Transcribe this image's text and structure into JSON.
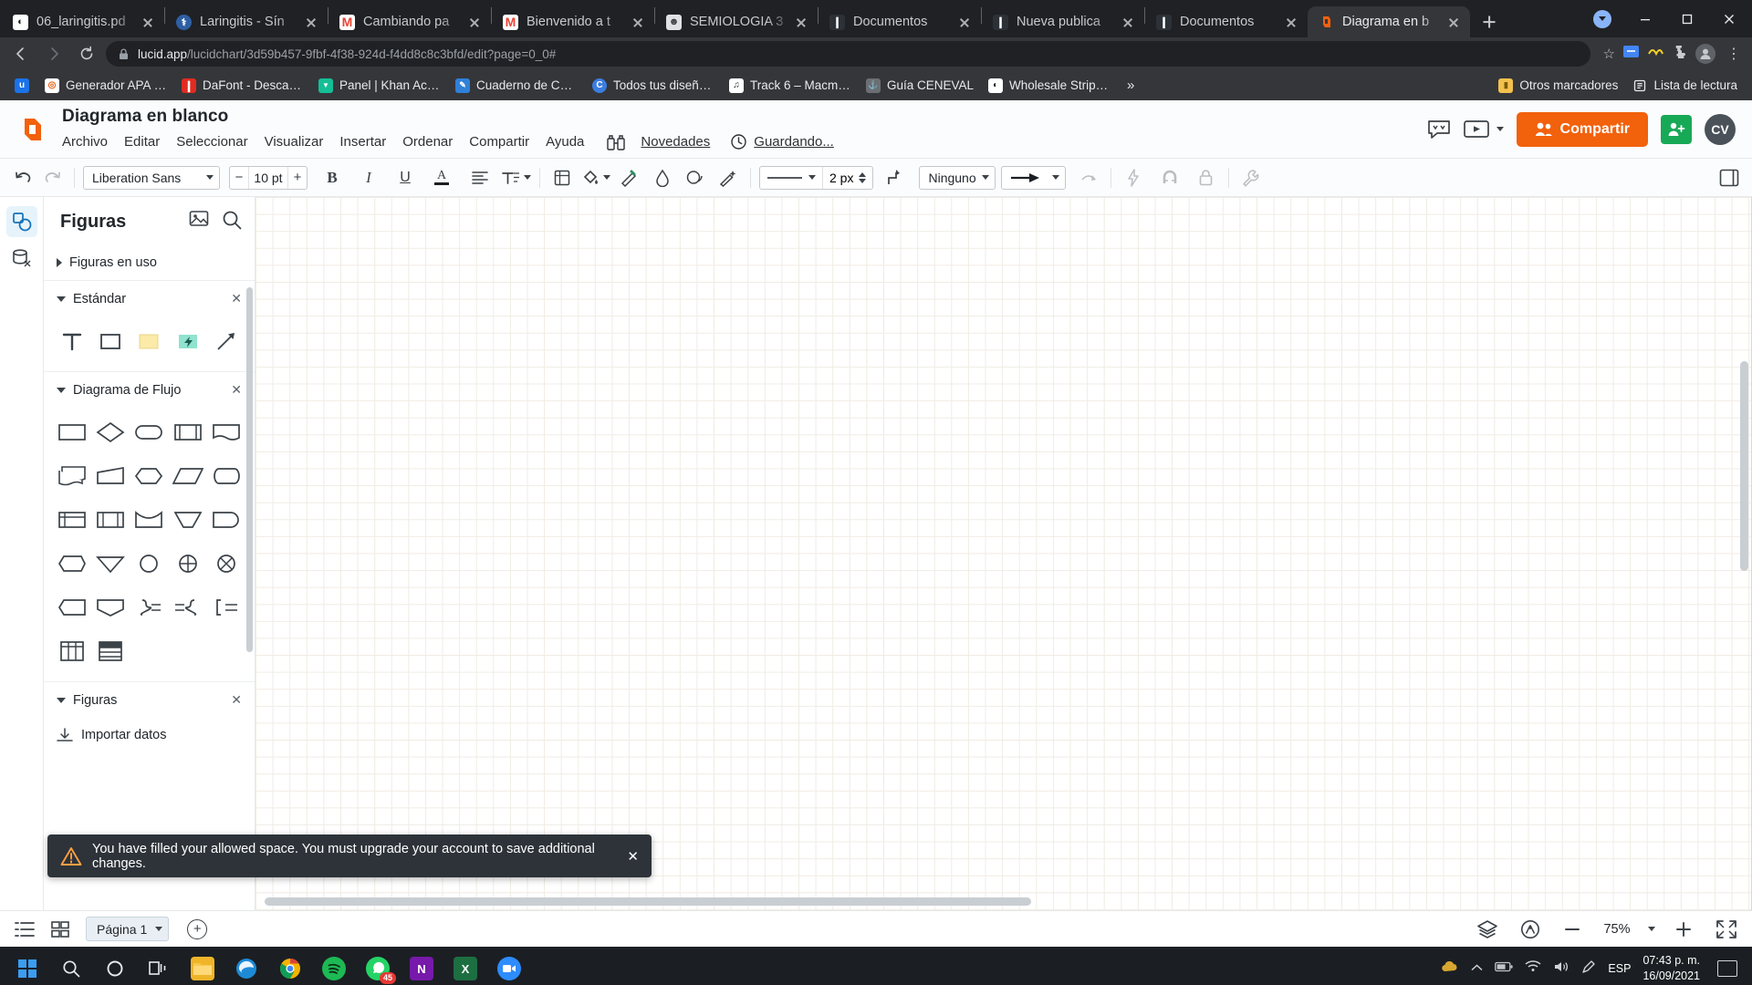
{
  "browser": {
    "tabs": [
      {
        "title": "06_laringitis.pd",
        "icon": "pdf-globe-icon",
        "icon_bg": "#ffffff",
        "icon_fg": "#1b1f23",
        "icon_char": "◔",
        "active": false
      },
      {
        "title": "Laringitis - Sín",
        "icon": "shield-icon",
        "icon_bg": "#2e5fa3",
        "icon_fg": "#ffffff",
        "icon_char": "⚕",
        "active": false
      },
      {
        "title": "Cambiando pa",
        "icon": "gmail-icon",
        "icon_bg": "#ffffff",
        "icon_fg": "#ea4335",
        "icon_char": "M",
        "active": false
      },
      {
        "title": "Bienvenido a t",
        "icon": "gmail-icon",
        "icon_bg": "#ffffff",
        "icon_fg": "#ea4335",
        "icon_char": "M",
        "active": false
      },
      {
        "title": "SEMIOLOGIA 3",
        "icon": "contact-card-icon",
        "icon_bg": "#dfe1e5",
        "icon_fg": "#3c4043",
        "icon_char": "☺",
        "active": false
      },
      {
        "title": "Documentos",
        "icon": "lucid-doc-icon",
        "icon_bg": "#2b3137",
        "icon_fg": "#ffffff",
        "icon_char": "❙",
        "active": false
      },
      {
        "title": "Nueva publica",
        "icon": "lucid-doc-icon",
        "icon_bg": "#2b3137",
        "icon_fg": "#ffffff",
        "icon_char": "❙",
        "active": false
      },
      {
        "title": "Documentos",
        "icon": "lucid-doc-icon",
        "icon_bg": "#2b3137",
        "icon_fg": "#ffffff",
        "icon_char": "❙",
        "active": false
      },
      {
        "title": "Diagrama en b",
        "icon": "lucid-logo-icon",
        "icon_bg": "transparent",
        "icon_fg": "#f2610c",
        "icon_char": "◧",
        "active": true
      }
    ],
    "new_tab_label": "Nueva pestaña",
    "url_domain": "lucid.app",
    "url_path": "/lucidchart/3d59b457-9fbf-4f38-924d-f4dd8c8c3bfd/edit?page=0_0#",
    "bookmarks": [
      {
        "label": "",
        "icon_bg": "#1a73e8",
        "icon_char": "u",
        "icon_fg": "#ffffff"
      },
      {
        "label": "Generador APA de...",
        "icon_bg": "#ffffff",
        "icon_char": "◎",
        "icon_fg": "#e8590c"
      },
      {
        "label": "DaFont - Descargar...",
        "icon_bg": "#e02b20",
        "icon_char": "❙",
        "icon_fg": "#ffffff"
      },
      {
        "label": "Panel | Khan Acade...",
        "icon_bg": "#14bf96",
        "icon_char": "▼",
        "icon_fg": "#ffffff"
      },
      {
        "label": "Cuaderno de Cultur...",
        "icon_bg": "#2f80d8",
        "icon_char": "✒",
        "icon_fg": "#ffffff"
      },
      {
        "label": "Todos tus diseños –...",
        "icon_bg": "#3b7ee0",
        "icon_char": "C",
        "icon_fg": "#ffffff"
      },
      {
        "label": "Track 6 – Macmillan...",
        "icon_bg": "#ffffff",
        "icon_char": "♫",
        "icon_fg": "#1b1f23"
      },
      {
        "label": "Guía CENEVAL",
        "icon_bg": "#6b6f73",
        "icon_char": "⚓",
        "icon_fg": "#d8dbde"
      },
      {
        "label": "Wholesale Stripe Pa...",
        "icon_bg": "#ffffff",
        "icon_char": "◔",
        "icon_fg": "#1b1f23"
      }
    ],
    "bookmarks_overflow": "»",
    "other_bookmarks": "Otros marcadores",
    "reading_list": "Lista de lectura"
  },
  "app": {
    "doc_title": "Diagrama en blanco",
    "menu": [
      "Archivo",
      "Editar",
      "Seleccionar",
      "Visualizar",
      "Insertar",
      "Ordenar",
      "Compartir",
      "Ayuda"
    ],
    "whats_new": "Novedades",
    "saving_status": "Guardando...",
    "share_button": "Compartir",
    "user_initials": "CV"
  },
  "toolbar": {
    "font_family": "Liberation Sans",
    "font_size": "10 pt",
    "minus": "−",
    "plus": "+",
    "bold": "B",
    "italic": "I",
    "underline": "U",
    "font_color": "A",
    "line_weight": "2 px",
    "arrow_start": "Ninguno"
  },
  "panel": {
    "title": "Figuras",
    "sections": [
      {
        "label": "Figuras en uso",
        "collapsed": true,
        "closable": false
      },
      {
        "label": "Estándar",
        "collapsed": false,
        "closable": true
      },
      {
        "label": "Diagrama de Flujo",
        "collapsed": false,
        "closable": true
      },
      {
        "label": "Figuras",
        "collapsed": false,
        "closable": true
      }
    ],
    "standard_shapes": [
      "text-shape",
      "rectangle-shape",
      "sticky-note-shape",
      "lightning-shape",
      "arrow-shape"
    ],
    "flowchart_shapes": [
      "process-rect",
      "decision-diamond",
      "terminator-oval",
      "predefined-process",
      "document-shape",
      "multidocument-shape",
      "manual-input",
      "preparation-hexagon",
      "data-parallelogram",
      "direct-data",
      "internal-storage",
      "stored-data",
      "manual-operation",
      "merge-triangle",
      "delay-shape",
      "display-shape",
      "extract-triangle",
      "connector-circle",
      "summing-junction",
      "or-junction",
      "off-page-ref",
      "card-shape",
      "merge-bracket",
      "sort-bracket",
      "collate-bracket",
      "table-shape",
      "list-shape"
    ],
    "import_label": "Importar datos"
  },
  "toast": {
    "message": "You have filled your allowed space.  You must upgrade your account to save additional changes.",
    "warning_icon": "warning-triangle-icon",
    "close": "✕"
  },
  "bottom": {
    "page_label": "Página 1",
    "zoom_level": "75%",
    "zoom_out": "−",
    "zoom_in": "+"
  },
  "taskbar": {
    "apps": [
      {
        "name": "file-explorer",
        "bg": "#f0b429",
        "char": "▤",
        "fg": "#6b4a00",
        "active": false
      },
      {
        "name": "microsoft-edge",
        "bg": "#1e8ad6",
        "char": "e",
        "fg": "#ffffff",
        "active": false
      },
      {
        "name": "google-chrome",
        "bg": "#e8eaed",
        "char": "●",
        "fg": "#4285f4",
        "active": true
      },
      {
        "name": "spotify",
        "bg": "#1db954",
        "char": "♫",
        "fg": "#0b2e16",
        "active": false
      },
      {
        "name": "whatsapp",
        "bg": "#25d366",
        "char": "✆",
        "fg": "#ffffff",
        "badge": "45",
        "active": false
      },
      {
        "name": "onenote",
        "bg": "#7719aa",
        "char": "N",
        "fg": "#ffffff",
        "active": false
      },
      {
        "name": "excel",
        "bg": "#1d6f42",
        "char": "X",
        "fg": "#ffffff",
        "active": false
      },
      {
        "name": "zoom-app",
        "bg": "#2d8cff",
        "char": "▶",
        "fg": "#ffffff",
        "active": false
      }
    ],
    "language": "ESP",
    "time": "07:43 p. m.",
    "date": "16/09/2021"
  }
}
